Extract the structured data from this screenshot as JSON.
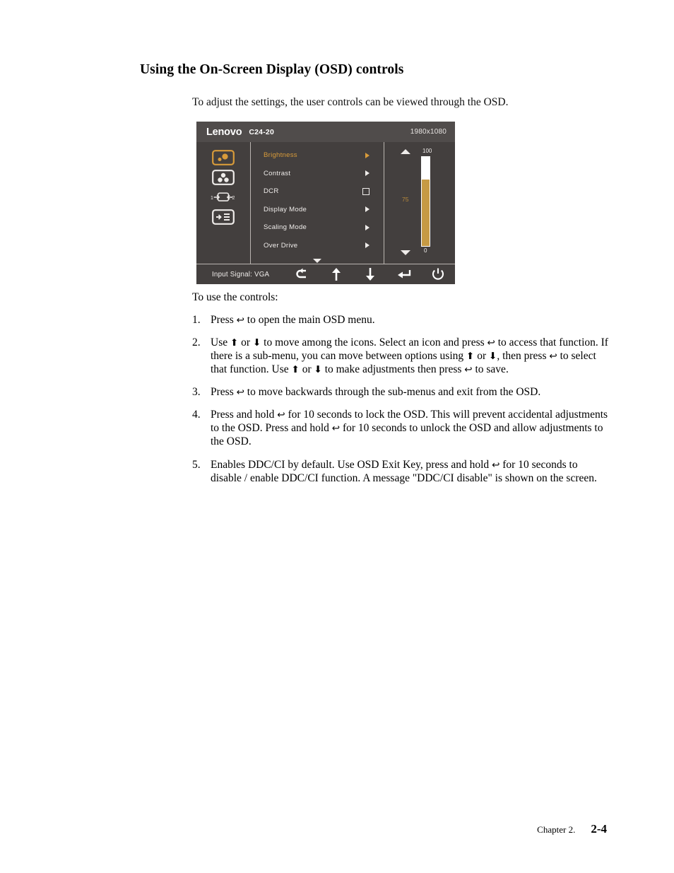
{
  "heading": "Using the On-Screen Display (OSD) controls",
  "intro": "To adjust the settings, the user controls can be viewed through the OSD.",
  "osd": {
    "brand": "Lenovo",
    "model": "C24-20",
    "resolution": "1980x1080",
    "rail_icons": [
      {
        "name": "brightness-contrast-icon",
        "selected": true
      },
      {
        "name": "color-settings-icon",
        "selected": false
      },
      {
        "name": "input-select-icon",
        "selected": false
      },
      {
        "name": "menu-settings-icon",
        "selected": false
      }
    ],
    "menu_items": [
      {
        "label": "Brightness",
        "control": "arrow",
        "selected": true
      },
      {
        "label": "Contrast",
        "control": "arrow",
        "selected": false
      },
      {
        "label": "DCR",
        "control": "checkbox",
        "selected": false
      },
      {
        "label": "Display Mode",
        "control": "arrow",
        "selected": false
      },
      {
        "label": "Scaling Mode",
        "control": "arrow",
        "selected": false
      },
      {
        "label": "Over Drive",
        "control": "arrow",
        "selected": false
      }
    ],
    "more_indicator": "chevron-down-icon",
    "slider": {
      "max_label": "100",
      "min_label": "0",
      "value_label": "75",
      "value": 75,
      "up_icon": "triangle-up-icon",
      "down_icon": "triangle-down-icon"
    },
    "footer": {
      "input_signal": "Input Signal: VGA",
      "buttons": [
        {
          "name": "back-icon"
        },
        {
          "name": "up-icon"
        },
        {
          "name": "down-icon"
        },
        {
          "name": "enter-icon"
        },
        {
          "name": "power-icon"
        }
      ]
    },
    "colors": {
      "background": "#433f3e",
      "header": "#504c4b",
      "accent": "#d89b3a",
      "slider_fill": "#c69a44",
      "text": "#efecea"
    }
  },
  "instructions": {
    "lead": "To use the controls:",
    "steps": [
      {
        "num": "1.",
        "text_parts": [
          "Press ",
          "↩",
          " to open the main OSD menu."
        ]
      },
      {
        "num": "2.",
        "text_parts": [
          "Use ",
          "⬆",
          " or ",
          "⬇",
          " to move among the icons. Select an icon and press ",
          "↩",
          " to access that  function. If there is a sub-menu, you can move between options using ",
          "⬆",
          " or ",
          "⬇",
          ",   then press  ",
          "↩",
          " to select that function. Use ",
          "⬆",
          " or ",
          "⬇",
          " to make adjustments then press ",
          "↩",
          " to save."
        ]
      },
      {
        "num": "3.",
        "text_parts": [
          "Press ",
          "↩",
          " to move backwards through the sub-menus and exit from the OSD."
        ]
      },
      {
        "num": "4.",
        "text_parts": [
          "Press and hold ",
          "↩",
          " for 10 seconds to lock the OSD. This will prevent accidental adjustments to the OSD. Press and hold ",
          "↩",
          " for 10 seconds to unlock the OSD and allow adjustments to the OSD."
        ]
      },
      {
        "num": "5.",
        "text_parts": [
          "Enables DDC/CI by default. Use OSD Exit Key, press  and hold ",
          "↩",
          " for 10 seconds to disable / enable DDC/CI function. A message \"DDC/CI disable\" is shown on the screen."
        ]
      }
    ]
  },
  "page_footer": {
    "chapter": "Chapter 2.",
    "page": "2-4"
  }
}
